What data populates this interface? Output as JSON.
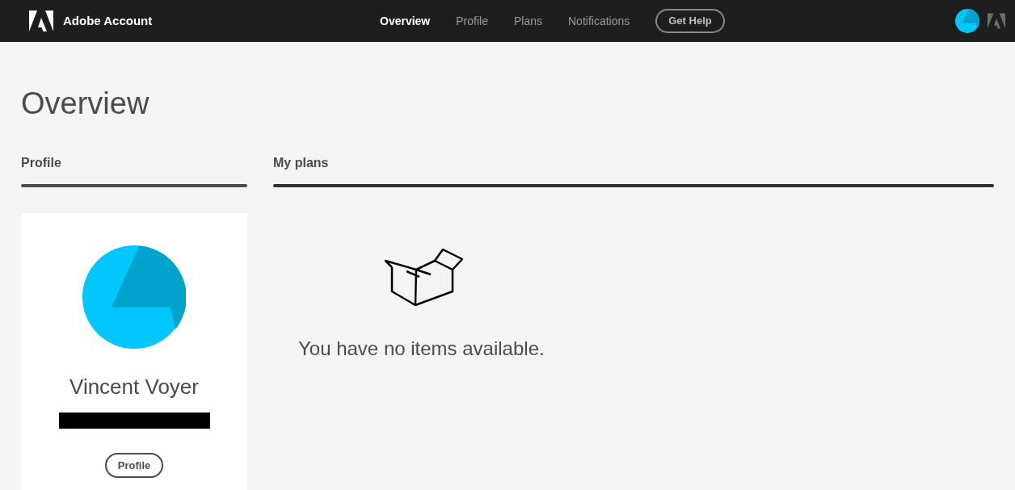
{
  "header": {
    "brand": "Adobe Account",
    "nav": [
      {
        "label": "Overview",
        "selected": true
      },
      {
        "label": "Profile",
        "selected": false
      },
      {
        "label": "Plans",
        "selected": false
      },
      {
        "label": "Notifications",
        "selected": false
      }
    ],
    "help_button": "Get Help"
  },
  "page_title": "Overview",
  "profile": {
    "heading": "Profile",
    "name": "Vincent Voyer",
    "button": "Profile"
  },
  "plans": {
    "heading": "My plans",
    "empty_message": "You have no items available."
  }
}
